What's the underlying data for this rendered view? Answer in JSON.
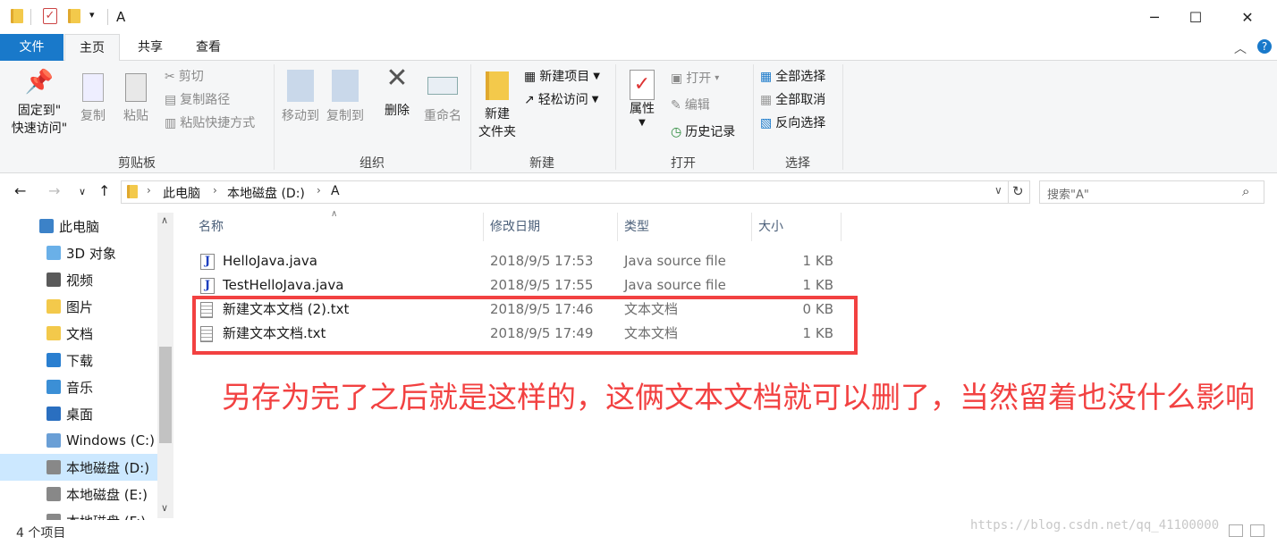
{
  "window": {
    "title": "A"
  },
  "ribbon_tabs": [
    "文件",
    "主页",
    "共享",
    "查看"
  ],
  "ribbon": {
    "clipboard": {
      "label": "剪贴板",
      "pin_line1": "固定到\"",
      "pin_line2": "快速访问\"",
      "copy": "复制",
      "paste": "粘贴",
      "cut": "剪切",
      "copy_path": "复制路径",
      "paste_shortcut": "粘贴快捷方式"
    },
    "organize": {
      "label": "组织",
      "move_to": "移动到",
      "copy_to": "复制到",
      "delete": "删除",
      "rename": "重命名"
    },
    "new": {
      "label": "新建",
      "new_folder_line1": "新建",
      "new_folder_line2": "文件夹",
      "new_item": "新建项目",
      "easy_access": "轻松访问"
    },
    "open": {
      "label": "打开",
      "properties": "属性",
      "open": "打开",
      "edit": "编辑",
      "history": "历史记录"
    },
    "select": {
      "label": "选择",
      "select_all": "全部选择",
      "select_none": "全部取消",
      "invert": "反向选择"
    }
  },
  "address": {
    "crumbs": [
      "此电脑",
      "本地磁盘 (D:)",
      "A"
    ],
    "search_placeholder": "搜索\"A\""
  },
  "nav_pane": [
    {
      "label": "此电脑",
      "icon": "computer-icon",
      "selected": false
    },
    {
      "label": "3D 对象",
      "icon": "folder-3d-icon",
      "selected": false
    },
    {
      "label": "视频",
      "icon": "video-folder-icon",
      "selected": false
    },
    {
      "label": "图片",
      "icon": "pictures-folder-icon",
      "selected": false
    },
    {
      "label": "文档",
      "icon": "documents-folder-icon",
      "selected": false
    },
    {
      "label": "下载",
      "icon": "downloads-folder-icon",
      "selected": false
    },
    {
      "label": "音乐",
      "icon": "music-folder-icon",
      "selected": false
    },
    {
      "label": "桌面",
      "icon": "desktop-folder-icon",
      "selected": false
    },
    {
      "label": "Windows (C:)",
      "icon": "windows-drive-icon",
      "selected": false
    },
    {
      "label": "本地磁盘 (D:)",
      "icon": "drive-icon",
      "selected": true
    },
    {
      "label": "本地磁盘 (E:)",
      "icon": "drive-icon",
      "selected": false
    },
    {
      "label": "本地磁盘 (F:)",
      "icon": "drive-icon",
      "selected": false
    }
  ],
  "columns": [
    "名称",
    "修改日期",
    "类型",
    "大小"
  ],
  "files": [
    {
      "name": "HelloJava.java",
      "date": "2018/9/5 17:53",
      "type": "Java source file",
      "size": "1 KB",
      "icon": "java-file-icon"
    },
    {
      "name": "TestHelloJava.java",
      "date": "2018/9/5 17:55",
      "type": "Java source file",
      "size": "1 KB",
      "icon": "java-file-icon"
    },
    {
      "name": "新建文本文档 (2).txt",
      "date": "2018/9/5 17:46",
      "type": "文本文档",
      "size": "0 KB",
      "icon": "text-file-icon"
    },
    {
      "name": "新建文本文档.txt",
      "date": "2018/9/5 17:49",
      "type": "文本文档",
      "size": "1 KB",
      "icon": "text-file-icon"
    }
  ],
  "annotation": "另存为完了之后就是这样的，这俩文本文档就可以删了，当然留着也没什么影响",
  "status": {
    "item_count": "4 个项目"
  },
  "watermark": "https://blog.csdn.net/qq_41100000",
  "colors": {
    "accent": "#1979ca",
    "annotation": "#f24141",
    "selection": "#cce8ff"
  }
}
